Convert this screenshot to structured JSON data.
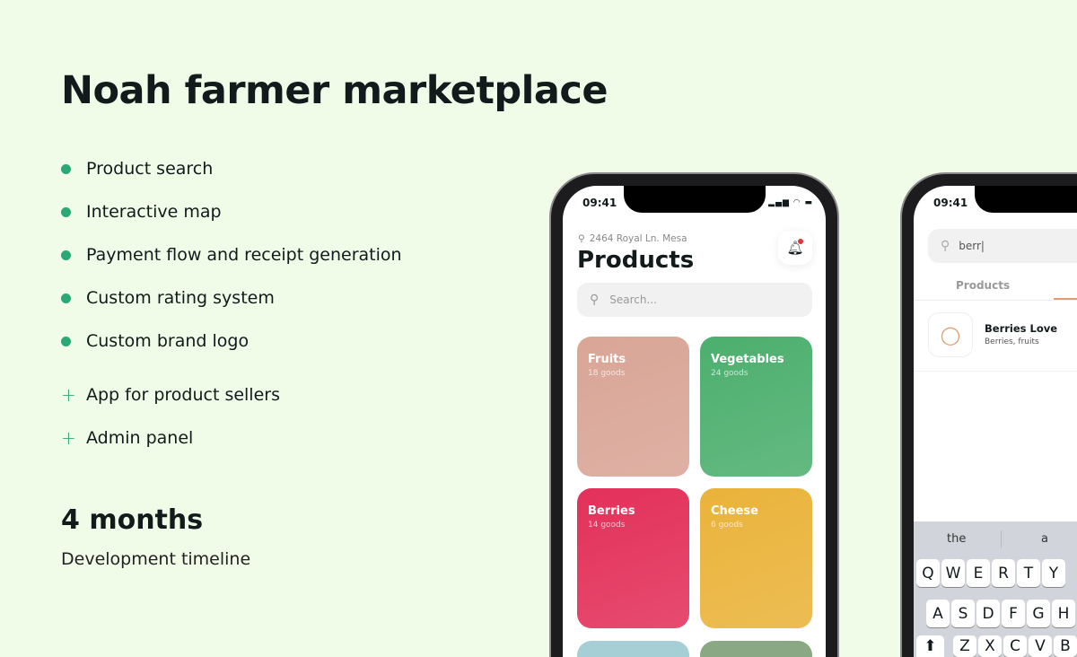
{
  "title": "Noah farmer marketplace",
  "features": [
    {
      "label": "Product search",
      "icon": "bullet"
    },
    {
      "label": "Interactive map",
      "icon": "bullet"
    },
    {
      "label": "Payment flow and receipt generation",
      "icon": "bullet"
    },
    {
      "label": "Custom rating system",
      "icon": "bullet"
    },
    {
      "label": "Custom brand logo",
      "icon": "bullet"
    },
    {
      "label": "App for product sellers",
      "icon": "plus"
    },
    {
      "label": "Admin panel",
      "icon": "plus"
    }
  ],
  "duration": "4 months",
  "duration_label": "Development timeline",
  "phone1": {
    "time": "09:41",
    "location": "2464 Royal Ln. Mesa",
    "heading": "Products",
    "search_placeholder": "Search...",
    "categories": [
      {
        "name": "Fruits",
        "count": "18 goods",
        "color": "#d9a596"
      },
      {
        "name": "Vegetables",
        "count": "24 goods",
        "color": "#4caf6e"
      },
      {
        "name": "Berries",
        "count": "14 goods",
        "color": "#e3305a"
      },
      {
        "name": "Cheese",
        "count": "6 goods",
        "color": "#eab33a"
      }
    ]
  },
  "phone2": {
    "time": "09:41",
    "search_value": "berr|",
    "tab": "Products",
    "results": [
      {
        "name": "Berries Love",
        "tags": "Berries, fruits"
      }
    ],
    "suggestions": [
      "the",
      "a"
    ],
    "keys_row1": [
      "Q",
      "W",
      "E",
      "R",
      "T",
      "Y"
    ],
    "keys_row2": [
      "A",
      "S",
      "D",
      "F",
      "G",
      "H"
    ],
    "keys_row3": [
      "Z",
      "X",
      "C",
      "V",
      "B"
    ]
  }
}
